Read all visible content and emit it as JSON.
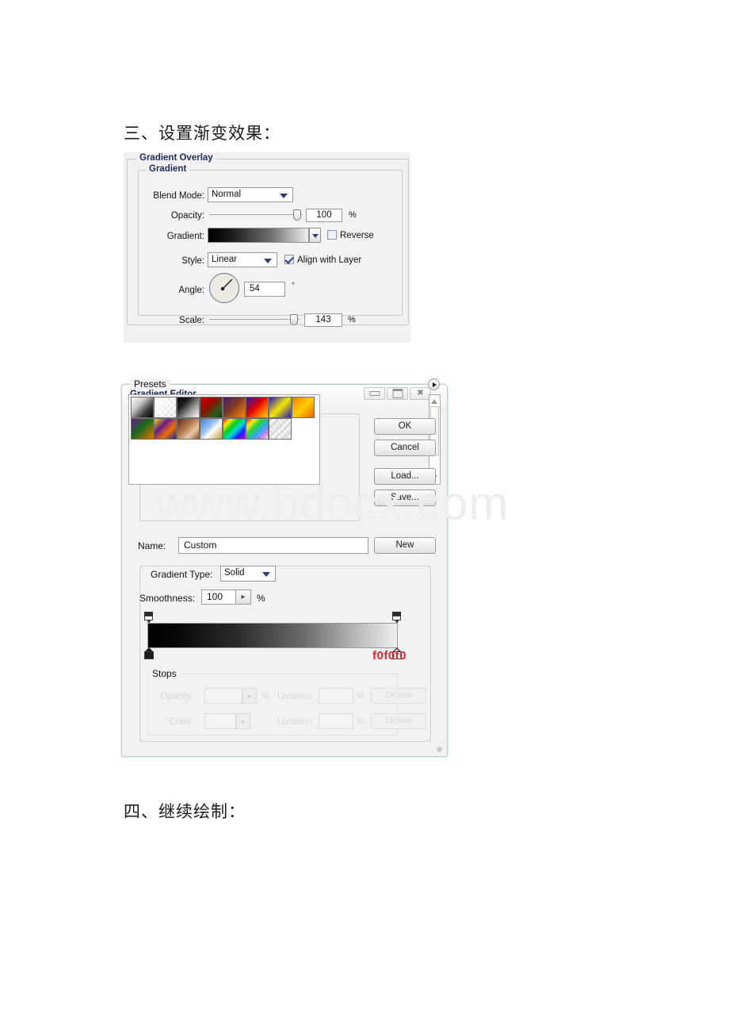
{
  "page": {
    "heading_three": "三、设置渐变效果：",
    "heading_four": "四、继续绘制：",
    "watermark": "www.bdocx.com"
  },
  "gradient_overlay": {
    "group_title": "Gradient Overlay",
    "subgroup_title": "Gradient",
    "blend_mode": {
      "label": "Blend Mode:",
      "value": "Normal"
    },
    "opacity": {
      "label": "Opacity:",
      "value": "100",
      "unit": "%"
    },
    "gradient": {
      "label": "Gradient:",
      "reverse_label": "Reverse",
      "reverse_checked": false
    },
    "style": {
      "label": "Style:",
      "value": "Linear",
      "align_label": "Align with Layer",
      "align_checked": true
    },
    "angle": {
      "label": "Angle:",
      "value": "54",
      "unit": "°"
    },
    "scale": {
      "label": "Scale:",
      "value": "143",
      "unit": "%"
    }
  },
  "gradient_editor": {
    "title": "Gradient Editor",
    "window_buttons": [
      "minimize-icon",
      "maximize-icon",
      "close-icon"
    ],
    "presets": {
      "label": "Presets",
      "menu_icon": "preset-menu-arrow-icon",
      "swatches": [
        "foreground-to-background",
        "foreground-to-transparent",
        "black-white",
        "red-green",
        "violet-orange",
        "blue-red-yellow",
        "blue-yellow-blue",
        "orange-yellow-orange",
        "violet-green-orange",
        "yellow-violet-orange-blue",
        "copper",
        "chrome",
        "spectrum",
        "transparent-rainbow",
        "transparent-stripes"
      ]
    },
    "buttons": {
      "ok": "OK",
      "cancel": "Cancel",
      "load": "Load...",
      "save": "Save...",
      "new": "New"
    },
    "name": {
      "label": "Name:",
      "value": "Custom"
    },
    "gradient_type": {
      "label": "Gradient Type:",
      "value": "Solid"
    },
    "smoothness": {
      "label": "Smoothness:",
      "value": "100",
      "unit": "%"
    },
    "hex_annotation": "f0f0f0",
    "stops": {
      "title": "Stops",
      "opacity_label": "Opacity:",
      "opacity_unit": "%",
      "opacity_location_label": "Location:",
      "opacity_location_unit": "%",
      "opacity_delete": "Delete",
      "color_label": "Color:",
      "color_location_label": "Location:",
      "color_location_unit": "%",
      "color_delete": "Delete"
    }
  }
}
